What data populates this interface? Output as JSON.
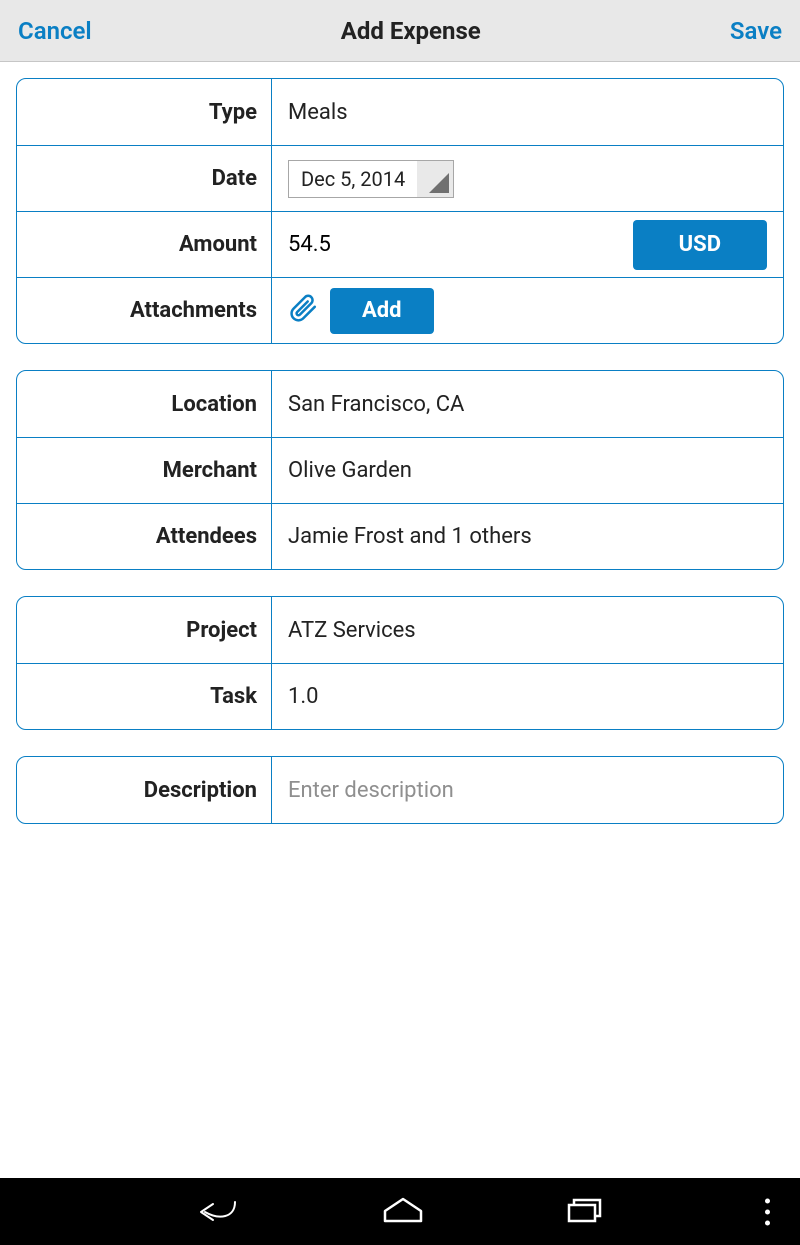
{
  "header": {
    "cancel": "Cancel",
    "title": "Add Expense",
    "save": "Save"
  },
  "section1": {
    "type_label": "Type",
    "type_value": "Meals",
    "date_label": "Date",
    "date_value": "Dec 5, 2014",
    "amount_label": "Amount",
    "amount_value": "54.5",
    "currency_label": "USD",
    "attachments_label": "Attachments",
    "add_button": "Add"
  },
  "section2": {
    "location_label": "Location",
    "location_value": "San Francisco, CA",
    "merchant_label": "Merchant",
    "merchant_value": "Olive Garden",
    "attendees_label": "Attendees",
    "attendees_value": "Jamie Frost and 1 others"
  },
  "section3": {
    "project_label": "Project",
    "project_value": "ATZ Services",
    "task_label": "Task",
    "task_value": "1.0"
  },
  "section4": {
    "description_label": "Description",
    "description_placeholder": "Enter description"
  }
}
